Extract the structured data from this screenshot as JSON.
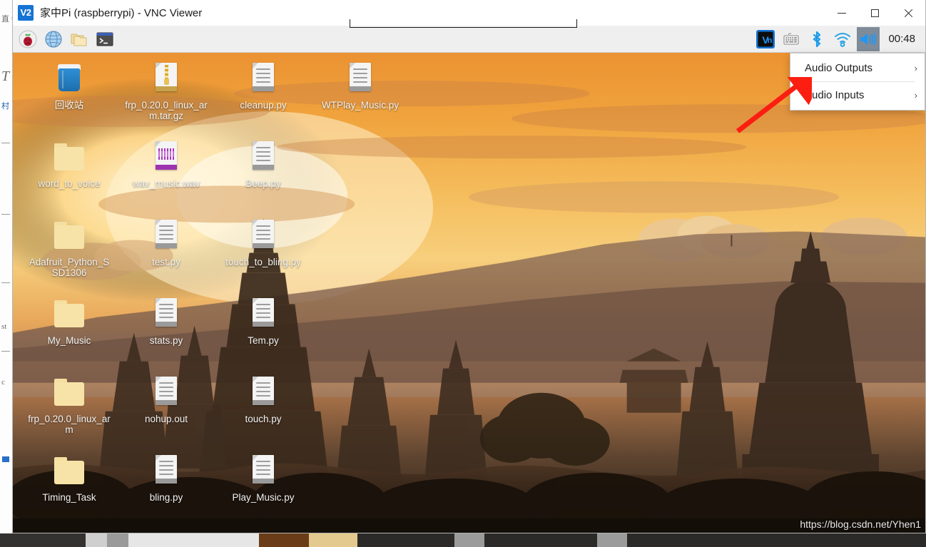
{
  "window": {
    "title": "家中Pi (raspberrypi) - VNC Viewer",
    "app_icon_text": "V2",
    "controls": {
      "minimize": "Minimize",
      "maximize": "Maximize",
      "close": "Close"
    }
  },
  "pi_panel": {
    "launchers": [
      {
        "name": "raspberry-menu",
        "label": "Menu"
      },
      {
        "name": "web-browser",
        "label": "Web Browser"
      },
      {
        "name": "file-manager",
        "label": "File Manager"
      },
      {
        "name": "terminal",
        "label": "Terminal"
      }
    ],
    "tray": [
      {
        "name": "vnc-server",
        "label": "VNC Server"
      },
      {
        "name": "keyboard",
        "label": "Keyboard Layout"
      },
      {
        "name": "bluetooth",
        "label": "Bluetooth"
      },
      {
        "name": "wifi",
        "label": "Wireless Network"
      },
      {
        "name": "volume",
        "label": "Volume Control",
        "active": true
      }
    ],
    "clock": "00:48"
  },
  "audio_menu": {
    "items": [
      {
        "label": "Audio Outputs",
        "arrow": "›"
      },
      {
        "label": "Audio Inputs",
        "arrow": "›"
      }
    ]
  },
  "desktop": {
    "watermark": "https://blog.csdn.net/Yhen1",
    "icons": [
      {
        "label": "回收站",
        "type": "trash",
        "col": 0,
        "row": 0
      },
      {
        "label": "frp_0.20.0_linux_arm.tar.gz",
        "type": "archive",
        "col": 1,
        "row": 0
      },
      {
        "label": "cleanup.py",
        "type": "doc",
        "col": 2,
        "row": 0
      },
      {
        "label": "WTPlay_Music.py",
        "type": "doc",
        "col": 3,
        "row": 0
      },
      {
        "label": "word_to_voice",
        "type": "folder",
        "col": 0,
        "row": 1
      },
      {
        "label": "wav_music.wav",
        "type": "wav",
        "col": 1,
        "row": 1
      },
      {
        "label": "Beep.py",
        "type": "doc",
        "col": 2,
        "row": 1
      },
      {
        "label": "Adafruit_Python_SSD1306",
        "type": "folder",
        "col": 0,
        "row": 2
      },
      {
        "label": "test.py",
        "type": "doc",
        "col": 1,
        "row": 2
      },
      {
        "label": "touch_to_bling.py",
        "type": "doc",
        "col": 2,
        "row": 2
      },
      {
        "label": "My_Music",
        "type": "folder",
        "col": 0,
        "row": 3
      },
      {
        "label": "stats.py",
        "type": "doc",
        "col": 1,
        "row": 3
      },
      {
        "label": "Tem.py",
        "type": "doc",
        "col": 2,
        "row": 3
      },
      {
        "label": "frp_0.20.0_linux_arm",
        "type": "folder",
        "col": 0,
        "row": 4
      },
      {
        "label": "nohup.out",
        "type": "doc",
        "col": 1,
        "row": 4
      },
      {
        "label": "touch.py",
        "type": "doc",
        "col": 2,
        "row": 4
      },
      {
        "label": "Timing_Task",
        "type": "folder",
        "col": 0,
        "row": 5
      },
      {
        "label": "bling.py",
        "type": "doc",
        "col": 1,
        "row": 5
      },
      {
        "label": "Play_Music.py",
        "type": "doc",
        "col": 2,
        "row": 5
      }
    ]
  },
  "host_background": {
    "ghost_lines": [
      "直 每",
      "T",
      "村",
      "st",
      "c"
    ]
  },
  "colors": {
    "accent_blue": "#1574d4",
    "tray_blue": "#29a3e3",
    "bluetooth_blue": "#1a9ae8",
    "volume_active_bg": "#7f8b99",
    "folder_yellow": "#f7e3a8",
    "annotation_red": "#fb1e11",
    "panel_bg": "#efefef",
    "sunset_orange": "#f0a33d"
  }
}
